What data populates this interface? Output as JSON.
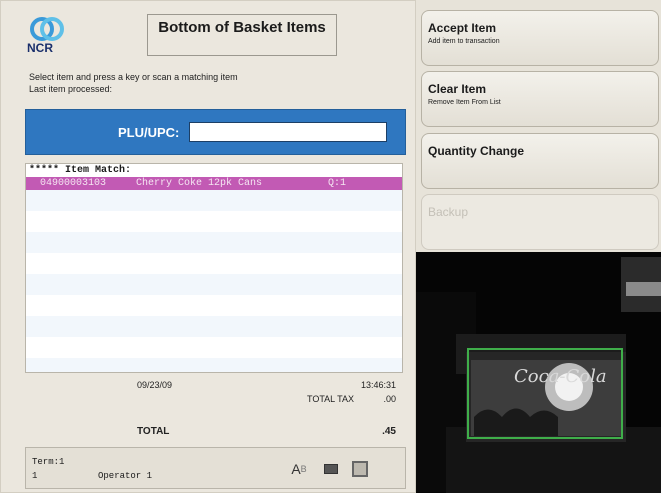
{
  "header": {
    "logo_text": "NCR",
    "title": "Bottom of Basket Items"
  },
  "instructions": {
    "line1": "Select item and press a key or scan a matching item",
    "line2": "Last item processed:"
  },
  "plu": {
    "label": "PLU/UPC:",
    "value": "",
    "placeholder": ""
  },
  "item_list": {
    "header": "***** Item Match:",
    "rows": [
      {
        "upc": "04900003103",
        "description": "Cherry Coke 12pk Cans",
        "qty": "Q:1",
        "selected": true
      }
    ]
  },
  "totals": {
    "date": "09/23/09",
    "time": "13:46:31",
    "tax_label": "TOTAL TAX",
    "tax_value": ".00",
    "total_label": "TOTAL",
    "total_value": ".45"
  },
  "status": {
    "term": "Term:1",
    "term_number": "1",
    "operator": "Operator 1",
    "icon_ab_main": "A",
    "icon_ab_sub": "B"
  },
  "buttons": {
    "accept": {
      "label": "Accept Item",
      "sub": "Add item to transaction"
    },
    "clear": {
      "label": "Clear Item",
      "sub": "Remove Item From List"
    },
    "quantity": {
      "label": "Quantity Change",
      "sub": ""
    },
    "backup": {
      "label": "Backup",
      "sub": ""
    }
  },
  "colors": {
    "plu_bar": "#2f77c0",
    "selected_row": "#c25ab4",
    "camera_box": "#3fae4a"
  },
  "icons": {
    "logo": "ncr-logo-icon",
    "ab": "text-input-icon",
    "kbd": "keyboard-icon",
    "drawer": "cash-drawer-icon"
  }
}
